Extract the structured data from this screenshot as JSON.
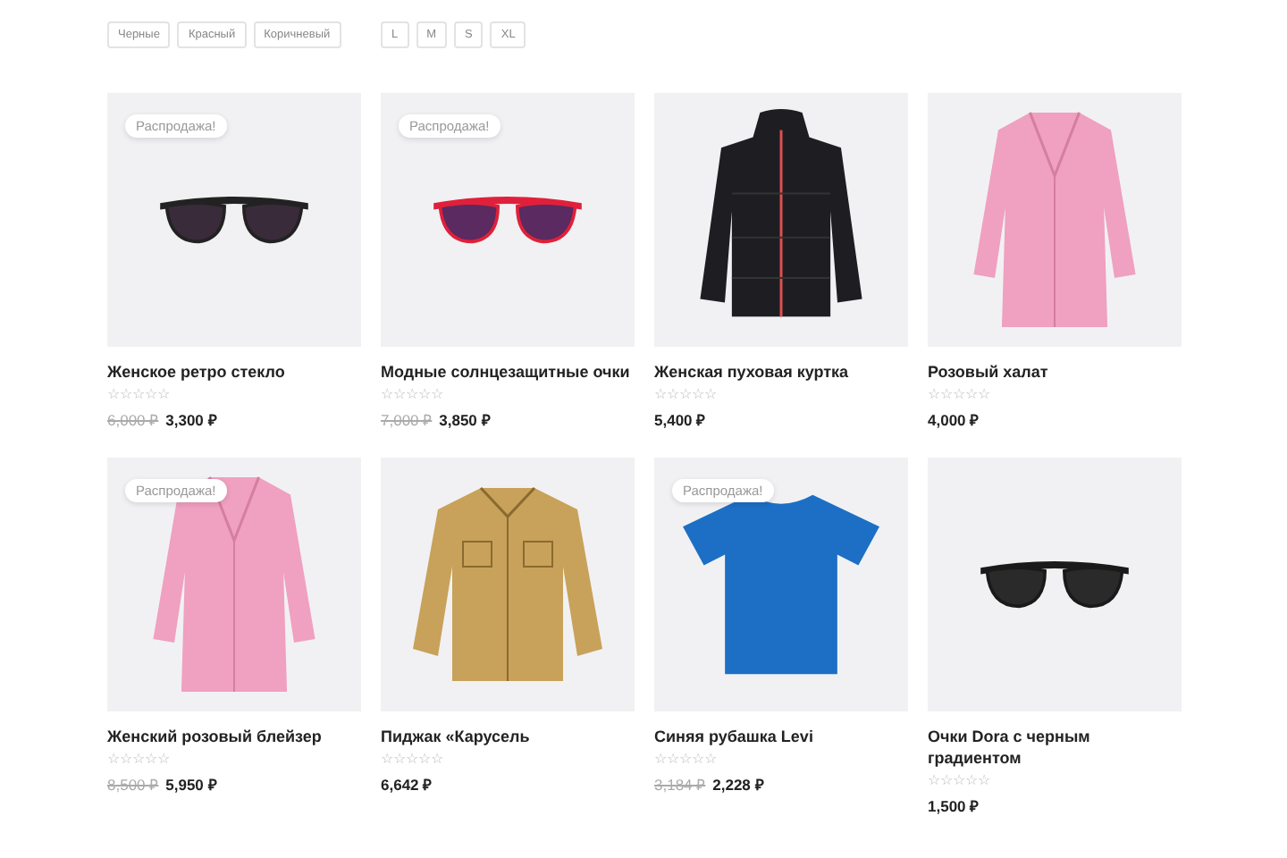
{
  "filters": {
    "colors": [
      "Черные",
      "Красный",
      "Коричневый"
    ],
    "sizes": [
      "L",
      "M",
      "S",
      "XL"
    ]
  },
  "products": [
    {
      "kind": "glasses",
      "badge": "Распродажа!",
      "title": "Женское ретро стекло",
      "stars": 0,
      "old_price": "6,000 ₽",
      "price": "3,300 ₽"
    },
    {
      "kind": "redglasses",
      "badge": "Распродажа!",
      "title": "Модные солнцезащитные очки",
      "stars": 0,
      "old_price": "7,000 ₽",
      "price": "3,850 ₽"
    },
    {
      "kind": "jacket",
      "title": "Женская пуховая куртка",
      "stars": 0,
      "price": "5,400 ₽"
    },
    {
      "kind": "coat",
      "title": "Розовый халат",
      "stars": 0,
      "price": "4,000 ₽"
    },
    {
      "kind": "coat",
      "badge": "Распродажа!",
      "title": "Женский розовый блейзер",
      "stars": 0,
      "old_price": "8,500 ₽",
      "price": "5,950 ₽"
    },
    {
      "kind": "shirt",
      "title": "Пиджак «Карусель",
      "stars": 0,
      "price": "6,642 ₽"
    },
    {
      "kind": "tshirt",
      "badge": "Распродажа!",
      "title": "Синяя рубашка Levi",
      "stars": 0,
      "old_price": "3,184 ₽",
      "price": "2,228 ₽"
    },
    {
      "kind": "darkglasses",
      "title": "Очки Dora с черным градиентом",
      "stars": 0,
      "price": "1,500 ₽"
    }
  ]
}
